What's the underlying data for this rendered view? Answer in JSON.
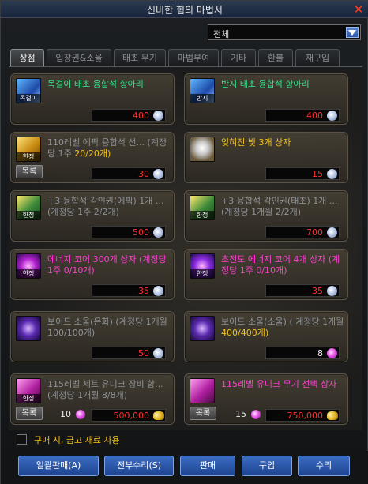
{
  "window": {
    "title": "신비한 힘의 마법서"
  },
  "filter": {
    "selected": "전체"
  },
  "tabs": [
    {
      "label": "상점"
    },
    {
      "label": "입장권&소울"
    },
    {
      "label": "태초 무기"
    },
    {
      "label": "마법부여"
    },
    {
      "label": "기타"
    },
    {
      "label": "환불"
    },
    {
      "label": "재구입"
    }
  ],
  "items": [
    {
      "name": "목걸이 태초 융합석 항아리",
      "qty": "",
      "icon_tag": "목걸이",
      "price": "400",
      "currency": "silver-coin-icon",
      "color": "green"
    },
    {
      "name": "반지 태초 융합석 항아리",
      "qty": "",
      "icon_tag": "반지",
      "price": "400",
      "currency": "silver-coin-icon",
      "color": "green"
    },
    {
      "name": "110레벨 에픽 융합석 선... (계정당 1주 ",
      "qty": "20/20개)",
      "icon_tag": "한정",
      "price": "30",
      "currency": "silver-coin-icon",
      "color": "grey",
      "button": "목록"
    },
    {
      "name": "잊혀진 빛 3개 상자",
      "qty": "",
      "icon_tag": "",
      "price": "15",
      "currency": "silver-coin-icon",
      "color": "gold"
    },
    {
      "name": "+3 융합석 각인권(에픽) 1개 ... (계정당 1주 ",
      "qty": "2/2개)",
      "icon_tag": "한정",
      "price": "500",
      "currency": "silver-coin-icon",
      "color": "grey"
    },
    {
      "name": "+3 융합석 각인권(태초) 1개 ... (계정당 1개월 ",
      "qty": "2/2개)",
      "icon_tag": "한정",
      "price": "700",
      "currency": "silver-coin-icon",
      "color": "grey"
    },
    {
      "name": "에너지 코어 300개 상자 (계정당 1주 0/10개)",
      "qty": "",
      "icon_tag": "한정",
      "price": "35",
      "currency": "silver-coin-icon",
      "color": "pink"
    },
    {
      "name": "초전도 에너지 코어 4개 상자 (계정당 1주 0/10개)",
      "qty": "",
      "icon_tag": "한정",
      "price": "35",
      "currency": "silver-coin-icon",
      "color": "pink"
    },
    {
      "name": "보이드 소울(은화) (계정당 1개월 100/100개)",
      "qty": "",
      "icon_tag": "",
      "price": "50",
      "currency": "silver-coin-icon",
      "color": "grey"
    },
    {
      "name": "보이드 소울(소울)  ( 계정당 1개월 ",
      "qty": "400/400개)",
      "icon_tag": "",
      "price": "8",
      "currency": "soul-gem-icon",
      "color": "grey"
    },
    {
      "name": "115레벨 세트 유니크 장비 항... (계정당 1개월 8/8개)",
      "qty": "",
      "icon_tag": "한정",
      "price": "500,000",
      "currency": "gold-icon",
      "color": "grey",
      "button": "목록",
      "count": "10"
    },
    {
      "name": "115레벨 유니크 무기 선택 상자",
      "qty": "",
      "icon_tag": "",
      "price": "750,000",
      "currency": "gold-icon",
      "color": "pink",
      "button": "목록",
      "count": "15"
    }
  ],
  "options": {
    "use_storage_label": "구매 시, 금고 재료 사용"
  },
  "footer": {
    "sell_all": "일괄판매(A)",
    "repair_all": "전부수리(S)",
    "sell": "판매",
    "buy": "구입",
    "repair": "수리"
  },
  "colors": {
    "accent_blue": "#2b55a8",
    "price_red": "#ff3030",
    "text_green": "#31e48c",
    "text_gold": "#f2c21a",
    "text_pink": "#ff3fd3"
  }
}
